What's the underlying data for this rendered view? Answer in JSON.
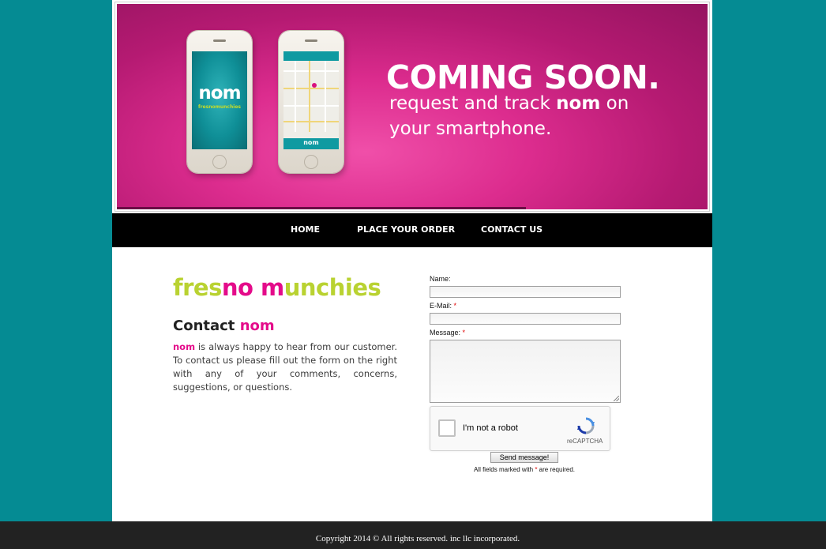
{
  "banner": {
    "headline": "COMING SOON.",
    "sub_line1_prefix": "request and track ",
    "sub_line1_brand": "nom",
    "sub_line1_suffix": " on",
    "sub_line2": "your smartphone.",
    "phone_splash_logo": "nom",
    "phone_splash_tag": "fresnomunchies",
    "phone_map_logo": "nom",
    "background_color": "#d92b8c"
  },
  "nav": {
    "items": [
      {
        "label": "HOME"
      },
      {
        "label": "PLACE YOUR ORDER"
      },
      {
        "label": "CONTACT US"
      }
    ]
  },
  "brand": {
    "part1": "fres",
    "part2": "no m",
    "part3": "unchies",
    "lime_color": "#b9d231",
    "pink_color": "#e40b8a"
  },
  "contact": {
    "heading_prefix": "Contact ",
    "heading_brand": "nom",
    "body_brand": "nom",
    "body_text": " is always happy to hear from our customer. To contact us please fill out the form on the right with any of your comments, concerns, suggestions, or questions."
  },
  "form": {
    "name_label": "Name:",
    "name_value": "",
    "email_label": "E-Mail:",
    "email_value": "",
    "message_label": "Message:",
    "message_value": "",
    "required_marker": "*",
    "captcha_label": "I'm not a robot",
    "captcha_brand": "reCAPTCHA",
    "send_label": "Send message!",
    "note_prefix": "All fields marked with ",
    "note_marker": "*",
    "note_suffix": " are required."
  },
  "footer": {
    "copyright": "Copyright 2014 © All rights reserved. inc llc incorporated."
  },
  "colors": {
    "page_background": "#058b93",
    "nav_background": "#000000",
    "footer_background": "#222222"
  }
}
